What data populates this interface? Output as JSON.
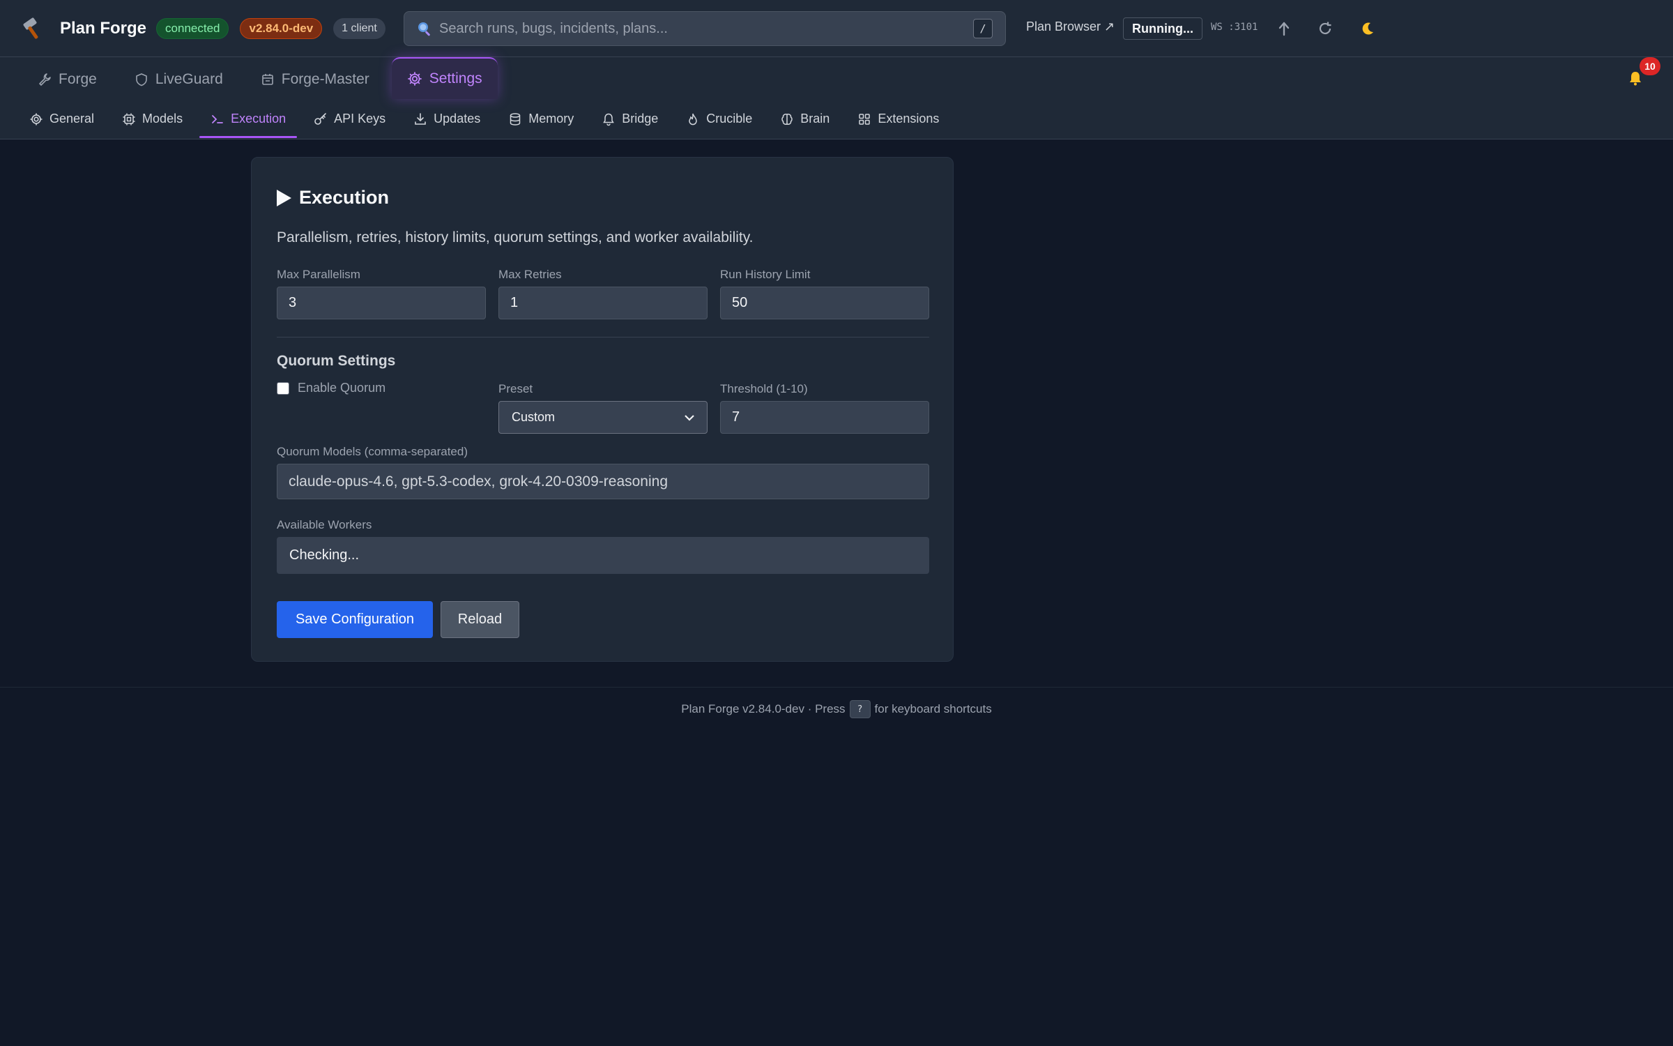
{
  "header": {
    "app_title": "Plan Forge",
    "status_badge": "connected",
    "version_badge": "v2.84.0-dev",
    "clients_badge": "1 client",
    "search_placeholder": "Search runs, bugs, incidents, plans...",
    "search_shortcut": "/",
    "plan_browser_link": "Plan Browser ↗",
    "running_button": "Running...",
    "ws_label": "WS :3101",
    "icons": [
      "hammer-icon",
      "search-icon",
      "upload-icon",
      "refresh-icon",
      "moon-icon",
      "bell-icon"
    ]
  },
  "top_tabs": [
    {
      "label": "Forge",
      "icon": "wrench-icon"
    },
    {
      "label": "LiveGuard",
      "icon": "shield-icon"
    },
    {
      "label": "Forge-Master",
      "icon": "calendar-icon"
    },
    {
      "label": "Settings",
      "icon": "gear-icon",
      "active": true
    }
  ],
  "notifications": {
    "count": "10"
  },
  "sub_tabs": [
    {
      "label": "General",
      "icon": "gear-icon"
    },
    {
      "label": "Models",
      "icon": "chip-icon"
    },
    {
      "label": "Execution",
      "icon": "terminal-icon",
      "active": true
    },
    {
      "label": "API Keys",
      "icon": "key-icon"
    },
    {
      "label": "Updates",
      "icon": "download-icon"
    },
    {
      "label": "Memory",
      "icon": "database-icon"
    },
    {
      "label": "Bridge",
      "icon": "bell-icon"
    },
    {
      "label": "Crucible",
      "icon": "flame-icon"
    },
    {
      "label": "Brain",
      "icon": "brain-icon"
    },
    {
      "label": "Extensions",
      "icon": "grid-icon"
    }
  ],
  "execution": {
    "title": "Execution",
    "description": "Parallelism, retries, history limits, quorum settings, and worker availability.",
    "max_parallelism_label": "Max Parallelism",
    "max_parallelism_value": "3",
    "max_retries_label": "Max Retries",
    "max_retries_value": "1",
    "run_history_label": "Run History Limit",
    "run_history_value": "50",
    "quorum_section_title": "Quorum Settings",
    "enable_quorum_label": "Enable Quorum",
    "enable_quorum_checked": false,
    "preset_label": "Preset",
    "preset_value": "Custom",
    "threshold_label": "Threshold (1-10)",
    "threshold_value": "7",
    "quorum_models_label": "Quorum Models (comma-separated)",
    "quorum_models_value": "claude-opus-4.6, gpt-5.3-codex, grok-4.20-0309-reasoning",
    "available_workers_label": "Available Workers",
    "available_workers_value": "Checking...",
    "save_button": "Save Configuration",
    "reload_button": "Reload"
  },
  "footer": {
    "prefix": "Plan Forge v2.84.0-dev · Press",
    "key": "?",
    "suffix": "for keyboard shortcuts"
  },
  "colors": {
    "background": "#111827",
    "panel": "#1f2937",
    "accent_purple": "#a855f7",
    "primary_blue": "#2563eb",
    "connected_green": "#86efac",
    "version_orange": "#fdba74",
    "notification_red": "#dc2626"
  }
}
